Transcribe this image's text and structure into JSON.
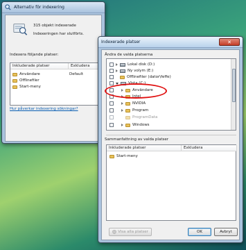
{
  "back_window": {
    "title": "Alternativ för indexering",
    "status_count": "315 objekt indexerade",
    "status_message": "Indexeringen har slutförts.",
    "section_label": "Indexera följande platser:",
    "columns": [
      "Inkluderade platser",
      "Exkludera"
    ],
    "rows": [
      {
        "name": "Användare",
        "exclude": "Default"
      },
      {
        "name": "Offlinefiler",
        "exclude": ""
      },
      {
        "name": "Start-meny",
        "exclude": ""
      }
    ],
    "help_link": "Hur påverkar indexering sökningar?"
  },
  "front_window": {
    "title": "Indexerade platser",
    "change_label": "Ändra de valda platserna",
    "tree": [
      {
        "label": "Lokal disk (D:)",
        "level": 0,
        "icon": "drive-icon",
        "arrow": "collapsed",
        "dimmed": false
      },
      {
        "label": "Ny volym (E:)",
        "level": 0,
        "icon": "drive-icon",
        "arrow": "collapsed",
        "dimmed": false
      },
      {
        "label": "Offlinefiler (dator\\feffe)",
        "level": 0,
        "icon": "folder-icon",
        "arrow": "none",
        "dimmed": false
      },
      {
        "label": "Vista (C:)",
        "level": 0,
        "icon": "drive-icon",
        "arrow": "expanded",
        "dimmed": false
      },
      {
        "label": "Användare",
        "level": 1,
        "icon": "folder-icon",
        "arrow": "collapsed",
        "dimmed": false
      },
      {
        "label": "Intel",
        "level": 1,
        "icon": "folder-icon",
        "arrow": "collapsed",
        "dimmed": false
      },
      {
        "label": "NVIDIA",
        "level": 1,
        "icon": "folder-icon",
        "arrow": "collapsed",
        "dimmed": false
      },
      {
        "label": "Program",
        "level": 1,
        "icon": "folder-icon",
        "arrow": "collapsed",
        "dimmed": false
      },
      {
        "label": "ProgramData",
        "level": 1,
        "icon": "folder-icon",
        "arrow": "none",
        "dimmed": true
      },
      {
        "label": "Windows",
        "level": 1,
        "icon": "folder-icon",
        "arrow": "collapsed",
        "dimmed": false
      }
    ],
    "summary_label": "Sammanfattning av valda platser",
    "summary_columns": [
      "Inkluderade platser",
      "Exkludera"
    ],
    "summary_rows": [
      {
        "name": "Start-meny",
        "exclude": ""
      }
    ],
    "show_all_button": "Visa alla platser",
    "ok_button": "OK",
    "cancel_button": "Avbryt"
  },
  "colors": {
    "annotation_circle": "#e01010",
    "close_button": "#c43d28"
  }
}
